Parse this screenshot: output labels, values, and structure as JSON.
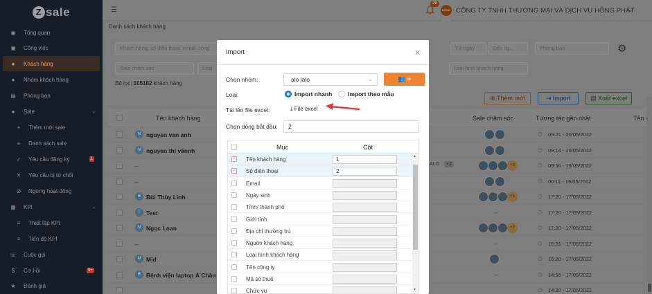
{
  "app": {
    "logo": "sale",
    "logo_letter": "Z"
  },
  "sidebar": {
    "items": [
      {
        "label": "Tổng quan",
        "icon": "dashboard-icon",
        "glyph": "◉"
      },
      {
        "label": "Công việc",
        "icon": "briefcase-icon",
        "glyph": "▣"
      },
      {
        "label": "Khách hàng",
        "icon": "user-icon",
        "glyph": "●"
      },
      {
        "label": "Nhóm khách hàng",
        "icon": "users-icon",
        "glyph": "●"
      },
      {
        "label": "Phòng ban",
        "icon": "building-icon",
        "glyph": "▤"
      },
      {
        "label": "Sale",
        "icon": "user-icon",
        "glyph": "●"
      },
      {
        "label": "Thêm mới sale",
        "icon": "user-plus-icon",
        "glyph": "+"
      },
      {
        "label": "Danh sách sale",
        "icon": "list-icon",
        "glyph": "≡"
      },
      {
        "label": "Yêu cầu đăng ký",
        "icon": "user-check-icon",
        "glyph": "✓",
        "badge": "1"
      },
      {
        "label": "Yêu cầu bị từ chối",
        "icon": "user-x-icon",
        "glyph": "✕"
      },
      {
        "label": "Ngừng hoạt động",
        "icon": "user-slash-icon",
        "glyph": "⊘"
      },
      {
        "label": "KPI",
        "icon": "chart-icon",
        "glyph": "▦"
      },
      {
        "label": "Thiết lập KPI",
        "icon": "sliders-icon",
        "glyph": "≡"
      },
      {
        "label": "Tiến độ KPI",
        "icon": "list-icon",
        "glyph": "≡"
      },
      {
        "label": "Cuộc gọi",
        "icon": "phone-icon",
        "glyph": "☏"
      },
      {
        "label": "Cơ hội",
        "icon": "dollar-icon",
        "glyph": "$",
        "badge": "9+"
      },
      {
        "label": "Đánh giá",
        "icon": "star-icon",
        "glyph": "★"
      }
    ]
  },
  "topbar": {
    "notification_count": "29",
    "company_avatar_text": "HỒNG PHÁT",
    "company_name": "CÔNG TY TNHH THƯƠNG MẠI VÀ DỊCH VỤ HỒNG PHÁT"
  },
  "page": {
    "breadcrumb": "Danh sách khách hàng",
    "filters": {
      "search_placeholder": "Khách hàng, số điện thoại, email, công",
      "from_date": "Từ ngày",
      "to_date": "Đến ng...",
      "department": "Phòng ban",
      "sale_care": "Sale chăm sóc",
      "type": "Loại",
      "customer_type": "Loại hình khách hàng"
    },
    "result_label": "Bộ lọc:",
    "result_count": "105182",
    "result_suffix": "khách hàng",
    "buttons": {
      "add_new": "Thêm mới",
      "import": "Import",
      "export": "Xuất excel"
    },
    "table": {
      "col_name": "Tên khách hàng",
      "col_sale": "Sale chăm sóc",
      "col_time": "Tương tác gần nhất",
      "col_more": "Tên c"
    },
    "rows": [
      {
        "name": "nguyen van anh",
        "time": "09:21 - 20/05/2022"
      },
      {
        "name": "nguyen thi vânnh",
        "time": "09:14 - 20/05/2022"
      },
      {
        "name": "--",
        "time": "09:56 - 19/05/2022",
        "tag": "ALO",
        "tag_more": "+2",
        "more": "+3"
      },
      {
        "name": "--",
        "time": "00:11 - 19/05/2022"
      },
      {
        "name": "Bùi Thùy Linh",
        "time": "17:20 - 17/05/2022",
        "more": "+1"
      },
      {
        "name": "Test",
        "time": "17:20 - 17/05/2022"
      },
      {
        "name": "Ngọc Loan",
        "time": "17:20 - 17/05/2022",
        "more": "+7"
      },
      {
        "name": "--",
        "time": "16:31 - 17/05/2022"
      },
      {
        "name": "Mid",
        "time": "16:20 - 17/05/2022"
      },
      {
        "name": "Bệnh viện laptop Á Châu",
        "time": "14:55 - 17/05/2022"
      },
      {
        "name": "",
        "time": "14:20 - 17/05/2022"
      }
    ]
  },
  "modal": {
    "title": "Import",
    "group_label": "Chọn nhóm:",
    "group_value": "alo lalo",
    "type_label": "Loại:",
    "type_options": [
      "Import nhanh",
      "Import theo mẫu"
    ],
    "file_label": "Tải lên file excel:",
    "file_link": "File excel",
    "start_row_label": "Chọn dòng bắt đầu:",
    "start_row_value": "2",
    "mapping": {
      "col_field": "Mục",
      "col_column": "Cột",
      "rows": [
        {
          "field": "Tên khách hàng",
          "column": "1",
          "checked": true
        },
        {
          "field": "Số điện thoại",
          "column": "2",
          "checked": true
        },
        {
          "field": "Email",
          "column": ""
        },
        {
          "field": "Ngày sinh",
          "column": ""
        },
        {
          "field": "Tỉnh/ thành phố",
          "column": ""
        },
        {
          "field": "Giới tính",
          "column": ""
        },
        {
          "field": "Địa chỉ thường trú",
          "column": ""
        },
        {
          "field": "Nguồn khách hàng",
          "column": ""
        },
        {
          "field": "Loại hình khách hàng",
          "column": ""
        },
        {
          "field": "Tên công ty",
          "column": ""
        },
        {
          "field": "Mã số thuế",
          "column": ""
        },
        {
          "field": "Chức vụ",
          "column": ""
        }
      ]
    }
  },
  "colors": {
    "accent_orange": "#ef8430",
    "radio_blue": "#1f7fe0",
    "arrow_red": "#e23b3b",
    "sidebar_bg": "#171c29"
  }
}
